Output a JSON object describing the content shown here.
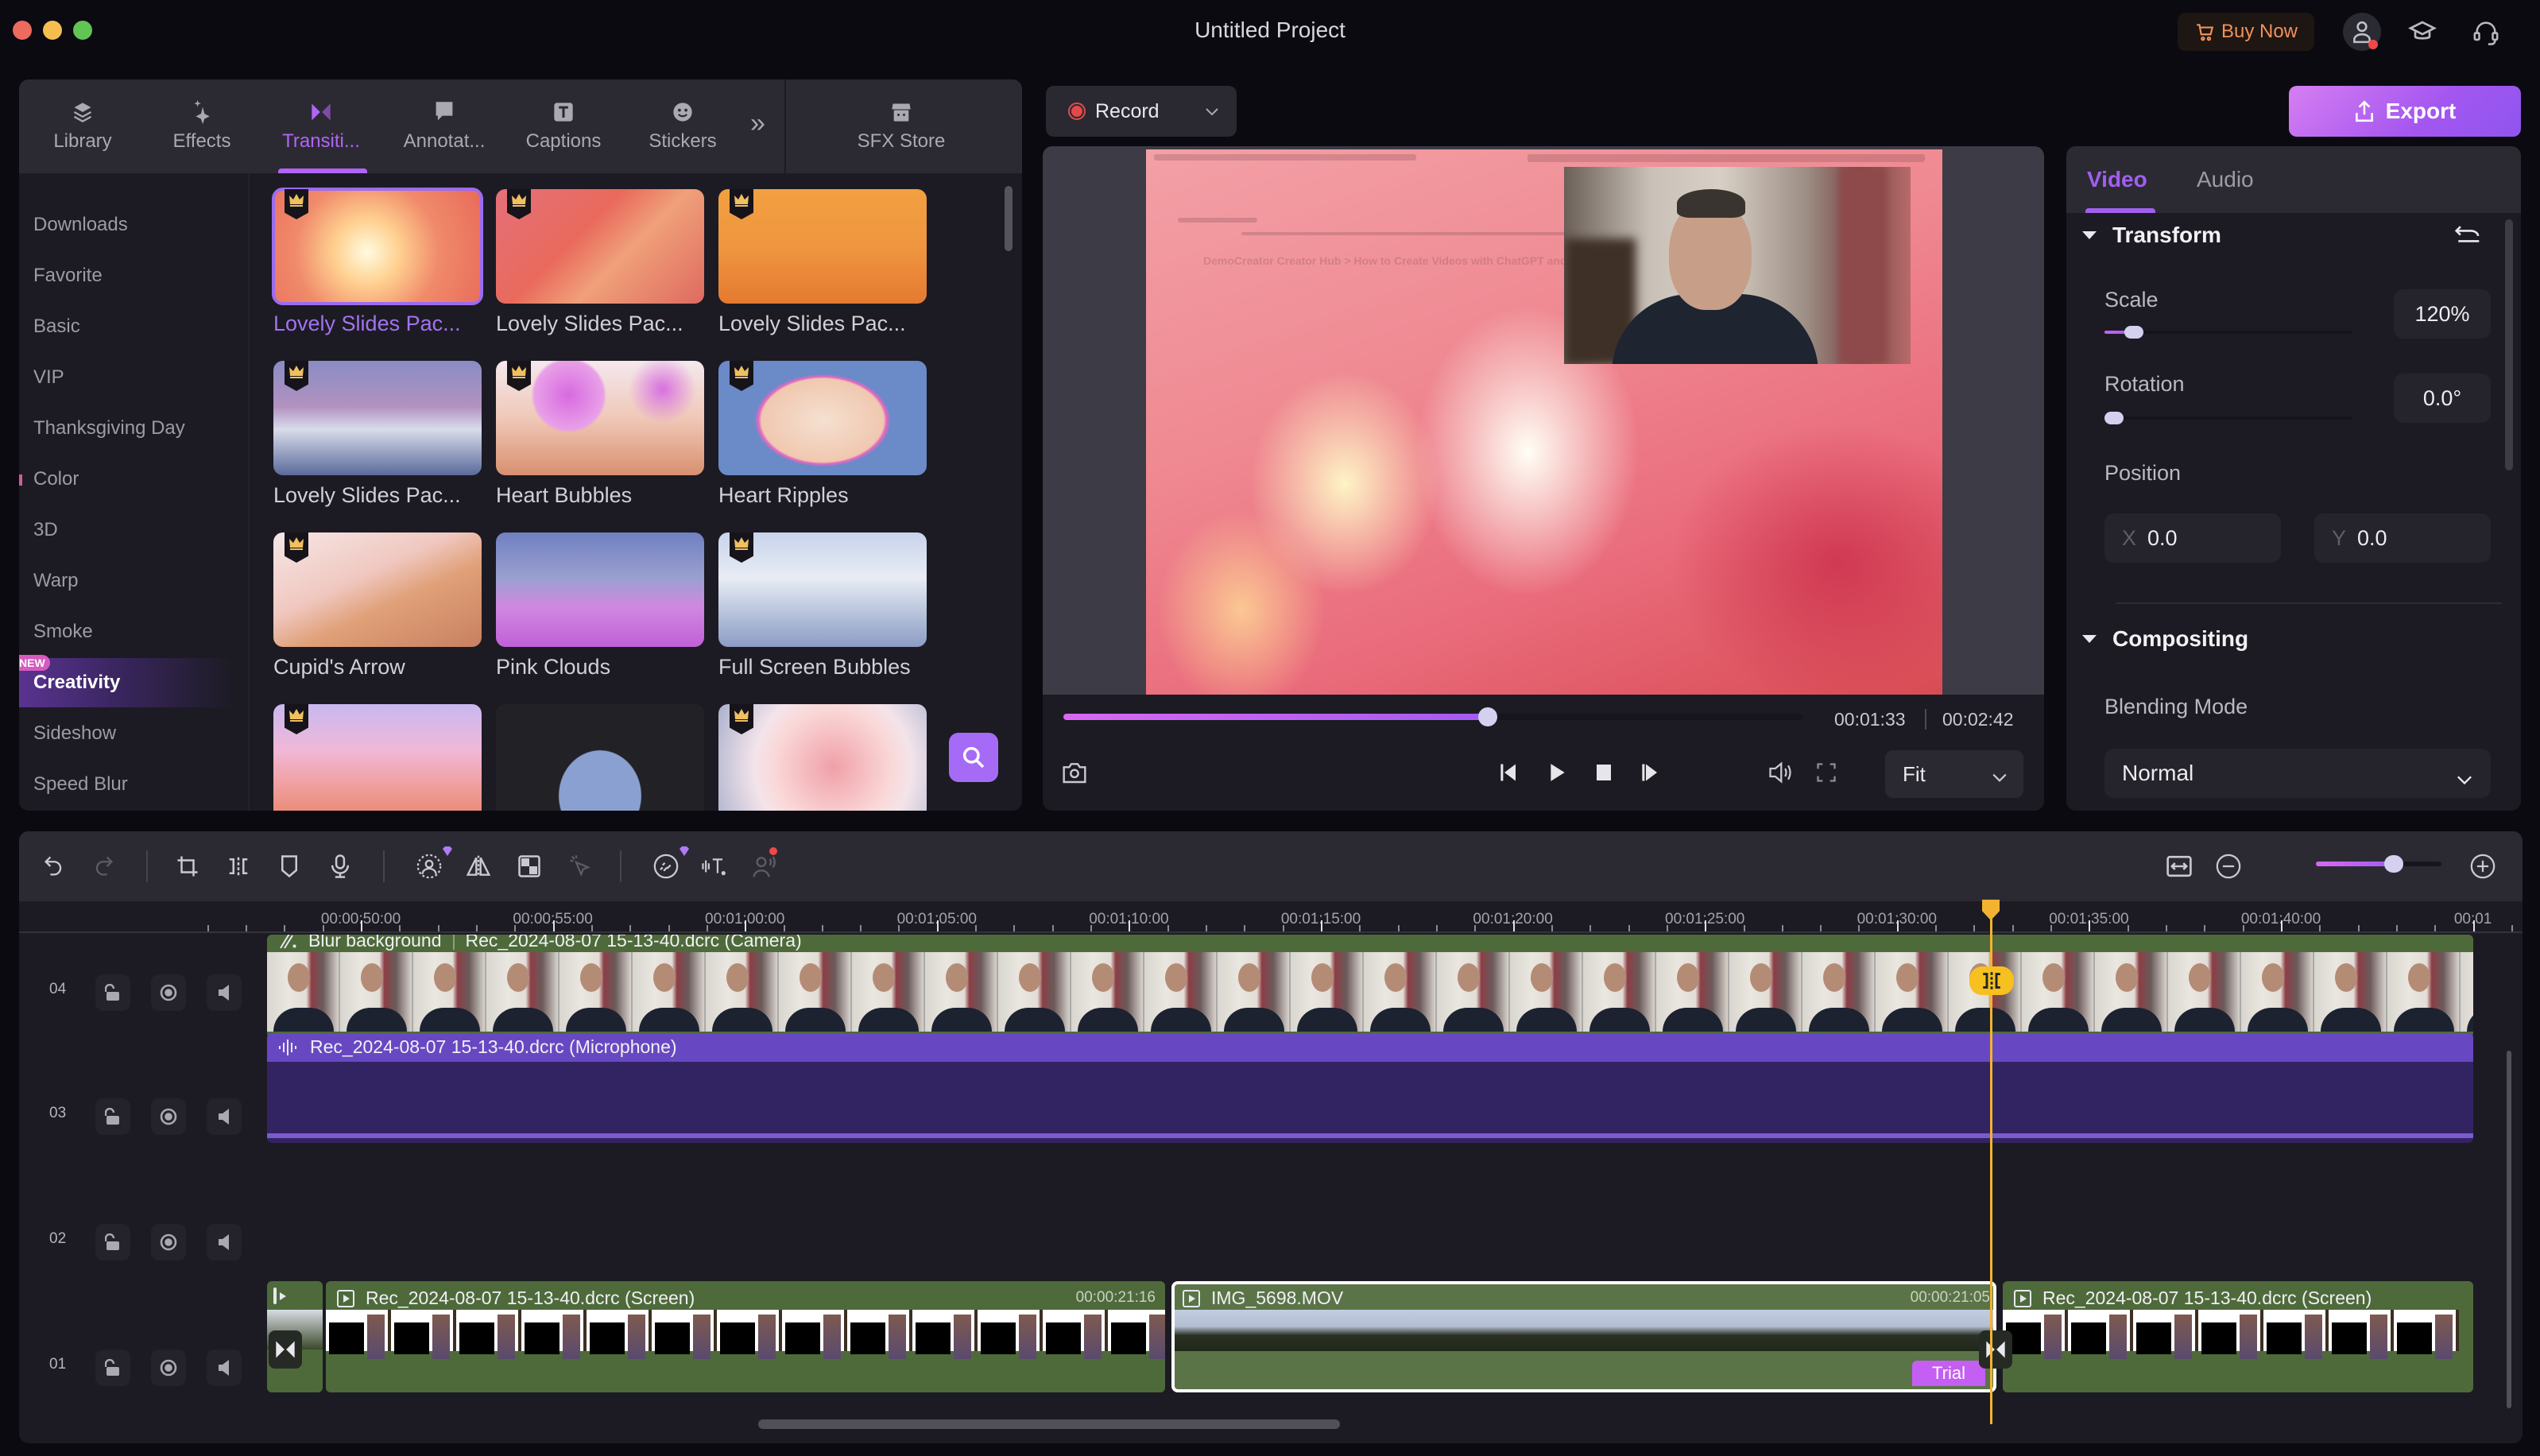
{
  "window": {
    "title": "Untitled Project",
    "buy_now": "Buy Now"
  },
  "left_panel": {
    "tabs": [
      {
        "label": "Library",
        "icon": "layers-icon"
      },
      {
        "label": "Effects",
        "icon": "sparkle-icon"
      },
      {
        "label": "Transiti...",
        "icon": "transition-icon",
        "active": true
      },
      {
        "label": "Annotat...",
        "icon": "annotation-icon"
      },
      {
        "label": "Captions",
        "icon": "captions-icon"
      },
      {
        "label": "Stickers",
        "icon": "sticker-icon"
      },
      {
        "label": "SFX Store",
        "icon": "store-icon"
      }
    ],
    "more": "»",
    "categories": [
      {
        "label": "Downloads"
      },
      {
        "label": "Favorite"
      },
      {
        "label": "Basic"
      },
      {
        "label": "VIP"
      },
      {
        "label": "Thanksgiving Day"
      },
      {
        "label": "Color"
      },
      {
        "label": "3D"
      },
      {
        "label": "Warp"
      },
      {
        "label": "Smoke"
      },
      {
        "label": "Creativity",
        "active": true,
        "badge": "NEW"
      },
      {
        "label": "Sideshow"
      },
      {
        "label": "Speed Blur"
      }
    ],
    "transitions": [
      {
        "label": "Lovely Slides Pac...",
        "premium": true,
        "selected": true
      },
      {
        "label": "Lovely Slides Pac...",
        "premium": true
      },
      {
        "label": "Lovely Slides Pac...",
        "premium": true
      },
      {
        "label": "Lovely Slides Pac...",
        "premium": true
      },
      {
        "label": "Heart Bubbles",
        "premium": true
      },
      {
        "label": "Heart Ripples",
        "premium": true
      },
      {
        "label": "Cupid's Arrow",
        "premium": true
      },
      {
        "label": "Pink Clouds",
        "premium": false
      },
      {
        "label": "Full Screen Bubbles",
        "premium": true
      },
      {
        "label": "",
        "premium": true
      },
      {
        "label": "",
        "premium": false
      },
      {
        "label": "",
        "premium": true
      }
    ]
  },
  "player": {
    "record_label": "Record",
    "export_label": "Export",
    "current_time": "00:01:33",
    "total_time": "00:02:42",
    "progress_fraction": 0.574,
    "fit_label": "Fit",
    "overlay_text": "DemoCreator Creator Hub > How to Create Videos with ChatGPT and Dem"
  },
  "properties": {
    "tabs": [
      {
        "label": "Video",
        "active": true
      },
      {
        "label": "Audio"
      }
    ],
    "transform": {
      "title": "Transform",
      "scale_label": "Scale",
      "scale_value": "120%",
      "scale_fraction": 0.12,
      "rotation_label": "Rotation",
      "rotation_value": "0.0°",
      "rotation_fraction": 0.0,
      "position_label": "Position",
      "x_axis": "X",
      "x_value": "0.0",
      "y_axis": "Y",
      "y_value": "0.0"
    },
    "compositing": {
      "title": "Compositing",
      "blending_label": "Blending Mode",
      "blending_value": "Normal"
    }
  },
  "timeline": {
    "zoom_fraction": 0.62,
    "ruler": [
      "00:00:50:00",
      "00:00:55:00",
      "00:01:00:00",
      "00:01:05:00",
      "00:01:10:00",
      "00:01:15:00",
      "00:01:20:00",
      "00:01:25:00",
      "00:01:30:00",
      "00:01:35:00",
      "00:01:40:00",
      "00:01"
    ],
    "tracks": [
      {
        "num": "04"
      },
      {
        "num": "03"
      },
      {
        "num": "02"
      },
      {
        "num": "01"
      }
    ],
    "clips": {
      "camera_effect": "Blur background",
      "camera": "Rec_2024-08-07 15-13-40.dcrc (Camera)",
      "microphone": "Rec_2024-08-07 15-13-40.dcrc (Microphone)",
      "screen_a": "Rec_2024-08-07 15-13-40.dcrc (Screen)",
      "screen_a_duration": "00:00:21:16",
      "mov": "IMG_5698.MOV",
      "mov_duration": "00:00:21:05",
      "mov_badge": "Trial",
      "screen_b": "Rec_2024-08-07 15-13-40.dcrc (Screen)"
    }
  }
}
